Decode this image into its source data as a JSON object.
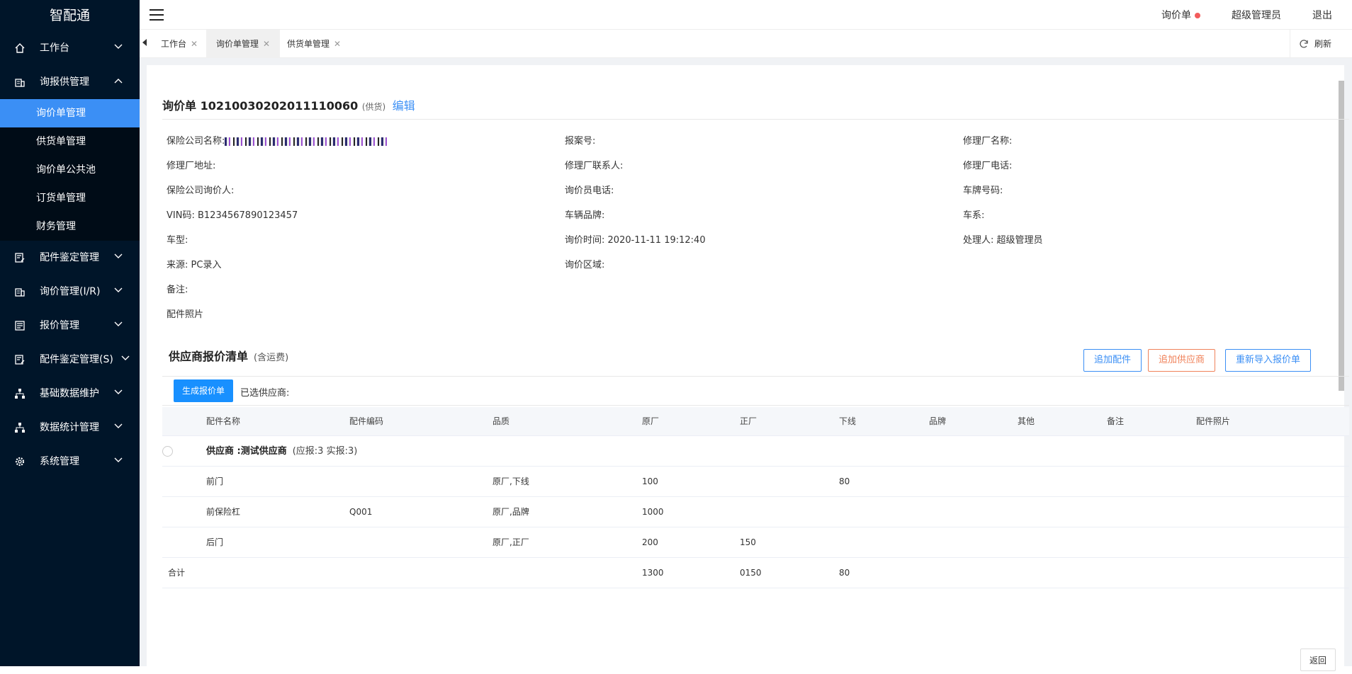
{
  "app": {
    "logo": "智配通"
  },
  "sidebar": {
    "items": [
      {
        "label": "工作台"
      },
      {
        "label": "询报供管理"
      },
      {
        "label": "配件鉴定管理"
      },
      {
        "label": "询价管理(I/R)"
      },
      {
        "label": "报价管理"
      },
      {
        "label": "配件鉴定管理(S)"
      },
      {
        "label": "基础数据维护"
      },
      {
        "label": "数据统计管理"
      },
      {
        "label": "系统管理"
      }
    ],
    "subitems": [
      {
        "label": "询价单管理"
      },
      {
        "label": "供货单管理"
      },
      {
        "label": "询价单公共池"
      },
      {
        "label": "订货单管理"
      },
      {
        "label": "财务管理"
      }
    ]
  },
  "header": {
    "inquiry": "询价单",
    "user": "超级管理员",
    "logout": "退出"
  },
  "tabs": [
    {
      "label": "工作台"
    },
    {
      "label": "询价单管理"
    },
    {
      "label": "供货单管理"
    }
  ],
  "refresh": "刷新",
  "record": {
    "title": "询价单",
    "number": "10210030202011110060",
    "type": "(供货)",
    "edit": "编辑"
  },
  "info": {
    "insurer_label": "保险公司名称:",
    "report_no_label": "报案号:",
    "shop_name_label": "修理厂名称:",
    "shop_addr_label": "修理厂地址:",
    "shop_contact_label": "修理厂联系人:",
    "shop_phone_label": "修理厂电话:",
    "insurer_inquirer_label": "保险公司询价人:",
    "inquirer_phone_label": "询价员电话:",
    "plate_label": "车牌号码:",
    "vin_label": "VIN码:",
    "vin_value": "B1234567890123457",
    "brand_label": "车辆品牌:",
    "series_label": "车系:",
    "model_label": "车型:",
    "time_label": "询价时间:",
    "time_value": "2020-11-11 19:12:40",
    "handler_label": "处理人:",
    "handler_value": "超级管理员",
    "source_label": "来源:",
    "source_value": "PC录入",
    "region_label": "询价区域:",
    "remark_label": "备注:",
    "photo_label": "配件照片"
  },
  "quote": {
    "title": "供应商报价清单",
    "subtitle": "(含运费)",
    "add_part": "追加配件",
    "add_supplier": "追加供应商",
    "reimport": "重新导入报价单",
    "generate": "生成报价单",
    "selected": "已选供应商:"
  },
  "table": {
    "columns": [
      "配件名称",
      "配件编码",
      "品质",
      "原厂",
      "正厂",
      "下线",
      "品牌",
      "其他",
      "备注",
      "配件照片"
    ],
    "supplier": {
      "name": "供应商 :测试供应商",
      "counts": "(应报:3 实报:3)"
    },
    "rows": [
      {
        "name": "前门",
        "code": "",
        "quality": "原厂,下线",
        "oem": "100",
        "genuine": "",
        "offline": "80"
      },
      {
        "name": "前保险杠",
        "code": "Q001",
        "quality": "原厂,品牌",
        "oem": "1000",
        "genuine": "",
        "offline": ""
      },
      {
        "name": "后门",
        "code": "",
        "quality": "原厂,正厂",
        "oem": "200",
        "genuine": "150",
        "offline": ""
      }
    ],
    "total": {
      "label": "合计",
      "oem": "1300",
      "genuine": "0150",
      "offline": "80"
    }
  },
  "back": "返回"
}
